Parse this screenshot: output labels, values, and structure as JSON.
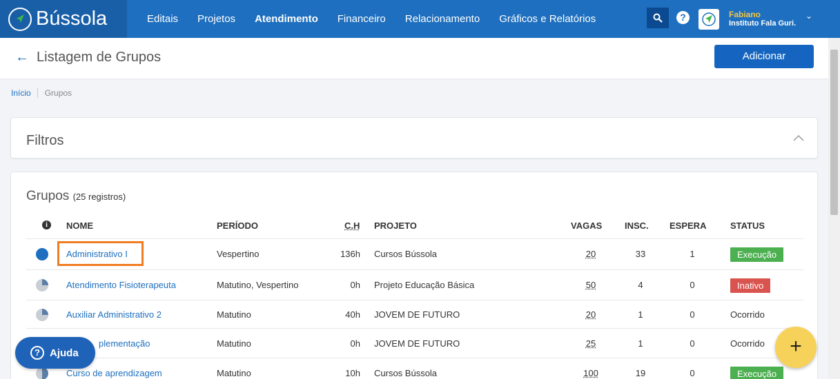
{
  "brand": {
    "name": "Bússola"
  },
  "nav": [
    "Editais",
    "Projetos",
    "Atendimento",
    "Financeiro",
    "Relacionamento",
    "Gráficos e Relatórios"
  ],
  "nav_active": "Atendimento",
  "user": {
    "name": "Fabiano",
    "org": "Instituto Fala Guri."
  },
  "page": {
    "title": "Listagem de Grupos",
    "add_label": "Adicionar"
  },
  "breadcrumb": {
    "home": "Início",
    "current": "Grupos"
  },
  "filters": {
    "title": "Filtros"
  },
  "groups": {
    "title": "Grupos",
    "count": "(25 registros)",
    "columns": {
      "name": "NOME",
      "period": "PERÍODO",
      "ch": "C.H",
      "project": "PROJETO",
      "vagas": "VAGAS",
      "insc": "INSC.",
      "espera": "ESPERA",
      "status": "STATUS"
    },
    "rows": [
      {
        "name": "Administrativo I",
        "period": "Vespertino",
        "ch": "136h",
        "project": "Cursos Bússola",
        "vagas": "20",
        "insc": "33",
        "espera": "1",
        "status": "Execução",
        "progress": 1.0
      },
      {
        "name": "Atendimento Fisioterapeuta",
        "period": "Matutino, Vespertino",
        "ch": "0h",
        "project": "Projeto Educação Básica",
        "vagas": "50",
        "insc": "4",
        "espera": "0",
        "status": "Inativo",
        "progress": 0.25
      },
      {
        "name": "Auxiliar Administrativo 2",
        "period": "Matutino",
        "ch": "40h",
        "project": "JOVEM DE FUTURO",
        "vagas": "20",
        "insc": "1",
        "espera": "0",
        "status": "Ocorrido",
        "progress": 0.25
      },
      {
        "name": "Complementação",
        "name_visible": "plementação",
        "period": "Matutino",
        "ch": "0h",
        "project": "JOVEM DE FUTURO",
        "vagas": "25",
        "insc": "1",
        "espera": "0",
        "status": "Ocorrido",
        "progress": 0.25
      },
      {
        "name": "Curso de aprendizagem",
        "period": "Matutino",
        "ch": "10h",
        "project": "Cursos Bússola",
        "vagas": "100",
        "insc": "19",
        "espera": "0",
        "status": "Execução",
        "progress": 0.5
      }
    ]
  },
  "help": {
    "label": "Ajuda"
  },
  "fab": {
    "label": "+"
  },
  "colors": {
    "topbar": "#1e6fbf",
    "brand_bg": "#195fa8",
    "accent": "#1565c0",
    "execucao": "#4caf50",
    "inativo": "#d9534f",
    "fab": "#f6d25a",
    "highlight": "#f07c22"
  },
  "icons": {
    "search": "search-icon",
    "help": "question-circle-icon",
    "back": "arrow-left-icon",
    "chevron": "chevron-up-icon",
    "info": "info-icon"
  }
}
